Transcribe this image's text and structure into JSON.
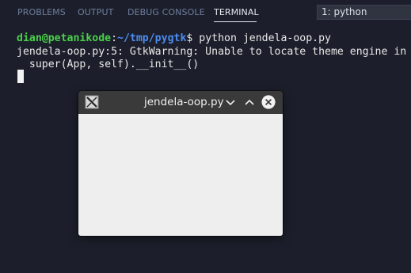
{
  "panel": {
    "tabs": [
      {
        "label": "PROBLEMS"
      },
      {
        "label": "OUTPUT"
      },
      {
        "label": "DEBUG CONSOLE"
      },
      {
        "label": "TERMINAL",
        "active": true
      }
    ],
    "terminal_select": "1: python"
  },
  "terminal": {
    "prompt_user": "dian@petanikode",
    "prompt_sep": ":",
    "prompt_path": "~/tmp/pygtk",
    "prompt_command": "$ python jendela-oop.py",
    "warning_line": "jendela-oop.py:5: GtkWarning: Unable to locate theme engine in module_path: \"pixmap\",",
    "code_line": "  super(App, self).__init__()"
  },
  "gtk_window": {
    "title": "jendela-oop.py",
    "icons": {
      "app": "x11-app-icon",
      "minimize": "chevron-down-icon",
      "maximize": "chevron-up-icon",
      "close": "close-circle-icon"
    }
  },
  "colors": {
    "background": "#1c1f2b",
    "prompt_user": "#4ad04a",
    "prompt_path": "#4c8cf0",
    "tab_inactive": "#6e7d9c",
    "tab_active": "#e6e9ef",
    "gtk_titlebar": "#3a3a3b",
    "gtk_body": "#eeeeee"
  }
}
